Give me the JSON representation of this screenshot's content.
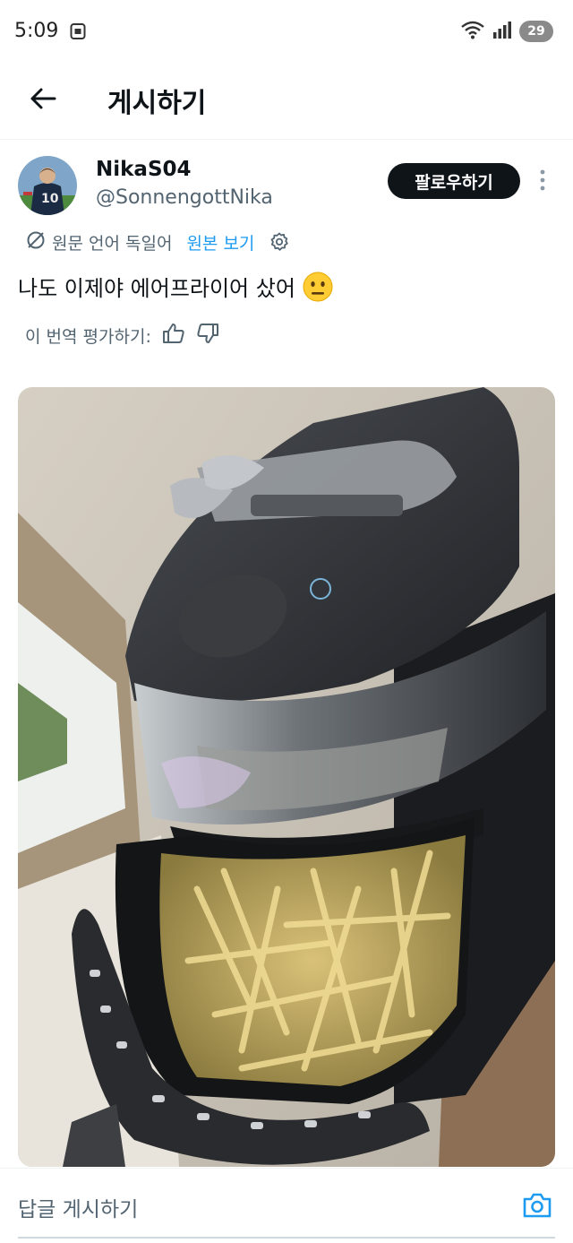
{
  "status_bar": {
    "time": "5:09",
    "battery": "29",
    "icons": [
      "screen-record-icon",
      "wifi-icon",
      "cell-signal-icon",
      "battery-icon"
    ]
  },
  "top_bar": {
    "title": "게시하기",
    "back_icon": "arrow-left-icon"
  },
  "post": {
    "display_name": "NikaS04",
    "handle": "@SonnengottNika",
    "follow_label": "팔로우하기",
    "translation_info": "원문 언어 독일어",
    "show_original_label": "원본 보기",
    "text": "나도 이제야 에어프라이어 샀어",
    "emoji": "neutral-face-emoji",
    "rate_translation_label": "이 번역 평가하기:"
  },
  "reply_bar": {
    "placeholder": "답글 게시하기",
    "camera_icon": "camera-icon"
  },
  "colors": {
    "accent": "#1d9bf0",
    "text_primary": "#0f1419",
    "text_secondary": "#536471",
    "follow_bg": "#0f1419"
  }
}
